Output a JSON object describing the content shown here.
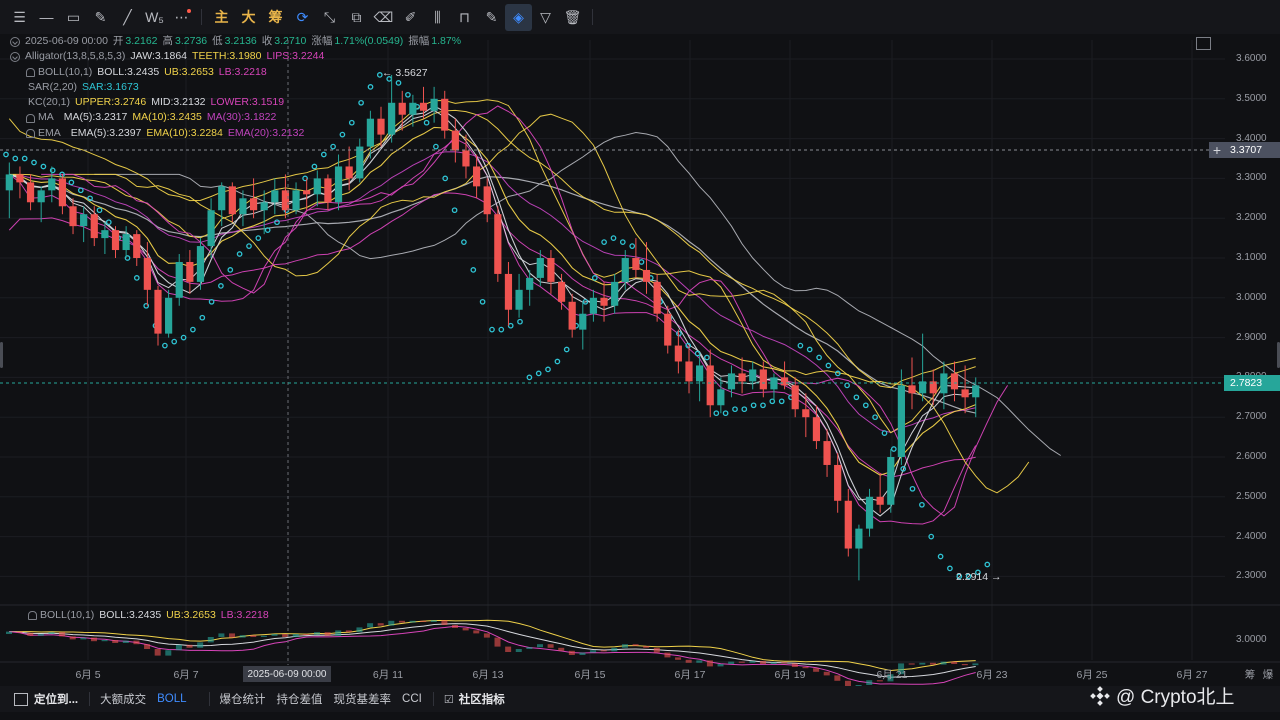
{
  "toolbar": {
    "tools": [
      {
        "icon": "menu-icon",
        "glyph": "☰"
      },
      {
        "icon": "horizontal-line-icon",
        "glyph": "—"
      },
      {
        "icon": "rectangle-icon",
        "glyph": "▭"
      },
      {
        "icon": "pen-icon",
        "glyph": "✎"
      },
      {
        "icon": "trend-line-icon",
        "glyph": "╱"
      },
      {
        "icon": "wave-icon",
        "glyph": "W₅"
      },
      {
        "icon": "more-icon",
        "glyph": "⋯"
      }
    ],
    "cn_buttons": [
      "主",
      "大",
      "筹"
    ],
    "tools2": [
      {
        "icon": "replay-icon",
        "glyph": "⟳"
      },
      {
        "icon": "measure-icon",
        "glyph": "⤡"
      },
      {
        "icon": "copy-icon",
        "glyph": "⧉"
      },
      {
        "icon": "eraser-icon",
        "glyph": "⌫"
      },
      {
        "icon": "highlighter-icon",
        "glyph": "✐"
      },
      {
        "icon": "candles-icon",
        "glyph": "⫼"
      },
      {
        "icon": "lock-icon",
        "glyph": "⊓"
      },
      {
        "icon": "edit-icon",
        "glyph": "✎"
      },
      {
        "icon": "magnet-icon",
        "glyph": "◈"
      },
      {
        "icon": "filter-icon",
        "glyph": "▽"
      },
      {
        "icon": "trash-icon",
        "glyph": "🗑"
      }
    ]
  },
  "legend": {
    "ohlc": {
      "date": "2025-06-09 00:00",
      "open_label": "开",
      "open": "3.2162",
      "high_label": "高",
      "high": "3.2736",
      "low_label": "低",
      "low": "3.2136",
      "close_label": "收",
      "close": "3.2710",
      "change_label": "涨幅",
      "change": "1.71%(0.0549)",
      "amp_label": "振幅",
      "amp": "1.87%"
    },
    "alligator": {
      "name": "Alligator(13,8,5,8,5,3)",
      "jaw": "JAW:3.1864",
      "teeth": "TEETH:3.1980",
      "lips": "LIPS:3.2244"
    },
    "boll": {
      "name": "BOLL(10,1)",
      "boll": "BOLL:3.2435",
      "ub": "UB:3.2653",
      "lb": "LB:3.2218"
    },
    "sar": {
      "name": "SAR(2,20)",
      "sar": "SAR:3.1673"
    },
    "kc": {
      "name": "KC(20,1)",
      "upper": "UPPER:3.2746",
      "mid": "MID:3.2132",
      "lower": "LOWER:3.1519"
    },
    "ma": {
      "name": "MA",
      "ma5": "MA(5):3.2317",
      "ma10": "MA(10):3.2435",
      "ma30": "MA(30):3.1822"
    },
    "ema": {
      "name": "EMA",
      "ema5": "EMA(5):3.2397",
      "ema10": "EMA(10):3.2284",
      "ema20": "EMA(20):3.2132"
    }
  },
  "sub_legend": {
    "name": "BOLL(10,1)",
    "boll": "BOLL:3.2435",
    "ub": "UB:3.2653",
    "lb": "LB:3.2218"
  },
  "annotations": {
    "high": "← 3.5627",
    "low": "2.2914 →"
  },
  "price_tags": {
    "crosshair": "3.3707",
    "last": "2.7823"
  },
  "sub_axis_label": "3.0000",
  "date_axis": {
    "ticks": [
      "6月 5",
      "6月 7",
      "6月 11",
      "6月 13",
      "6月 15",
      "6月 17",
      "6月 19",
      "6月 21",
      "6月 23",
      "6月 25",
      "6月 27"
    ],
    "crosshair": "2025-06-09 00:00",
    "right_labels": [
      "筹",
      "爆"
    ]
  },
  "bottombar": {
    "items": [
      "定位到...",
      "大额成交",
      "BOLL",
      "爆仓统计",
      "持仓差值",
      "现货基差率",
      "CCI",
      "社区指标"
    ]
  },
  "watermark": "@ Crypto北上",
  "colors": {
    "up": "#26a69a",
    "down": "#ef5350",
    "sar": "#2fc4d4",
    "yellow": "#f0d24a",
    "pink": "#d744b9",
    "grey": "#a9abb0",
    "last_tag": "#26a69a",
    "cross_tag": "#4c5160"
  },
  "chart_data": {
    "type": "candlestick",
    "ylim": [
      2.22,
      3.62
    ],
    "y_ticks": [
      2.3,
      2.4,
      2.5,
      2.6,
      2.7,
      2.8,
      2.9,
      3.0,
      3.1,
      3.2,
      3.3,
      3.4,
      3.5,
      3.6
    ],
    "candles": [
      [
        3.27,
        3.34,
        3.2,
        3.31
      ],
      [
        3.31,
        3.33,
        3.25,
        3.29
      ],
      [
        3.29,
        3.31,
        3.22,
        3.24
      ],
      [
        3.24,
        3.28,
        3.19,
        3.27
      ],
      [
        3.27,
        3.33,
        3.24,
        3.3
      ],
      [
        3.3,
        3.31,
        3.21,
        3.23
      ],
      [
        3.23,
        3.25,
        3.16,
        3.18
      ],
      [
        3.18,
        3.23,
        3.14,
        3.21
      ],
      [
        3.21,
        3.23,
        3.13,
        3.15
      ],
      [
        3.15,
        3.19,
        3.11,
        3.17
      ],
      [
        3.17,
        3.18,
        3.1,
        3.12
      ],
      [
        3.12,
        3.18,
        3.1,
        3.16
      ],
      [
        3.16,
        3.17,
        3.08,
        3.1
      ],
      [
        3.1,
        3.14,
        2.98,
        3.02
      ],
      [
        3.02,
        3.03,
        2.88,
        2.91
      ],
      [
        2.91,
        3.02,
        2.9,
        3.0
      ],
      [
        3.0,
        3.11,
        2.98,
        3.09
      ],
      [
        3.09,
        3.12,
        3.01,
        3.04
      ],
      [
        3.04,
        3.15,
        3.02,
        3.13
      ],
      [
        3.13,
        3.25,
        3.1,
        3.22
      ],
      [
        3.22,
        3.29,
        3.18,
        3.28
      ],
      [
        3.28,
        3.29,
        3.19,
        3.21
      ],
      [
        3.21,
        3.27,
        3.18,
        3.25
      ],
      [
        3.25,
        3.3,
        3.2,
        3.22
      ],
      [
        3.22,
        3.27,
        3.16,
        3.24
      ],
      [
        3.24,
        3.3,
        3.21,
        3.27
      ],
      [
        3.27,
        3.31,
        3.2,
        3.22
      ],
      [
        3.22,
        3.29,
        3.21,
        3.27
      ],
      [
        3.27,
        3.3,
        3.22,
        3.26
      ],
      [
        3.26,
        3.32,
        3.23,
        3.3
      ],
      [
        3.3,
        3.31,
        3.22,
        3.24
      ],
      [
        3.24,
        3.36,
        3.22,
        3.33
      ],
      [
        3.33,
        3.38,
        3.27,
        3.3
      ],
      [
        3.3,
        3.4,
        3.29,
        3.38
      ],
      [
        3.38,
        3.47,
        3.35,
        3.45
      ],
      [
        3.45,
        3.48,
        3.38,
        3.41
      ],
      [
        3.41,
        3.56,
        3.39,
        3.49
      ],
      [
        3.49,
        3.52,
        3.42,
        3.46
      ],
      [
        3.46,
        3.51,
        3.43,
        3.49
      ],
      [
        3.49,
        3.53,
        3.45,
        3.47
      ],
      [
        3.47,
        3.53,
        3.44,
        3.5
      ],
      [
        3.5,
        3.52,
        3.4,
        3.42
      ],
      [
        3.42,
        3.45,
        3.34,
        3.37
      ],
      [
        3.37,
        3.41,
        3.3,
        3.33
      ],
      [
        3.33,
        3.36,
        3.25,
        3.28
      ],
      [
        3.28,
        3.3,
        3.19,
        3.21
      ],
      [
        3.21,
        3.23,
        3.04,
        3.06
      ],
      [
        3.06,
        3.09,
        2.93,
        2.97
      ],
      [
        2.97,
        3.06,
        2.95,
        3.02
      ],
      [
        3.02,
        3.07,
        2.98,
        3.05
      ],
      [
        3.05,
        3.12,
        3.03,
        3.1
      ],
      [
        3.1,
        3.12,
        3.01,
        3.04
      ],
      [
        3.04,
        3.06,
        2.97,
        2.99
      ],
      [
        2.99,
        3.01,
        2.9,
        2.92
      ],
      [
        2.92,
        2.99,
        2.87,
        2.96
      ],
      [
        2.96,
        3.02,
        2.94,
        3.0
      ],
      [
        3.0,
        3.04,
        2.94,
        2.98
      ],
      [
        2.98,
        3.06,
        2.96,
        3.04
      ],
      [
        3.04,
        3.12,
        3.02,
        3.1
      ],
      [
        3.1,
        3.15,
        3.05,
        3.07
      ],
      [
        3.07,
        3.14,
        3.01,
        3.04
      ],
      [
        3.04,
        3.06,
        2.94,
        2.96
      ],
      [
        2.96,
        2.98,
        2.86,
        2.88
      ],
      [
        2.88,
        2.92,
        2.81,
        2.84
      ],
      [
        2.84,
        2.88,
        2.76,
        2.79
      ],
      [
        2.79,
        2.86,
        2.74,
        2.83
      ],
      [
        2.83,
        2.87,
        2.7,
        2.73
      ],
      [
        2.73,
        2.8,
        2.71,
        2.77
      ],
      [
        2.77,
        2.83,
        2.75,
        2.81
      ],
      [
        2.81,
        2.85,
        2.76,
        2.79
      ],
      [
        2.79,
        2.84,
        2.77,
        2.82
      ],
      [
        2.82,
        2.84,
        2.75,
        2.77
      ],
      [
        2.77,
        2.81,
        2.74,
        2.8
      ],
      [
        2.8,
        2.84,
        2.77,
        2.78
      ],
      [
        2.78,
        2.8,
        2.7,
        2.72
      ],
      [
        2.72,
        2.76,
        2.65,
        2.7
      ],
      [
        2.7,
        2.73,
        2.62,
        2.64
      ],
      [
        2.64,
        2.67,
        2.55,
        2.58
      ],
      [
        2.58,
        2.61,
        2.46,
        2.49
      ],
      [
        2.49,
        2.52,
        2.35,
        2.37
      ],
      [
        2.37,
        2.43,
        2.29,
        2.42
      ],
      [
        2.42,
        2.52,
        2.4,
        2.5
      ],
      [
        2.5,
        2.56,
        2.46,
        2.48
      ],
      [
        2.48,
        2.62,
        2.46,
        2.6
      ],
      [
        2.6,
        2.82,
        2.58,
        2.78
      ],
      [
        2.78,
        2.85,
        2.72,
        2.76
      ],
      [
        2.76,
        2.91,
        2.74,
        2.79
      ],
      [
        2.79,
        2.82,
        2.73,
        2.76
      ],
      [
        2.76,
        2.84,
        2.72,
        2.81
      ],
      [
        2.81,
        2.84,
        2.74,
        2.77
      ],
      [
        2.77,
        2.83,
        2.71,
        2.75
      ],
      [
        2.75,
        2.8,
        2.7,
        2.78
      ]
    ],
    "sar": [
      3.36,
      3.35,
      3.35,
      3.34,
      3.33,
      3.32,
      3.31,
      3.29,
      3.27,
      3.25,
      3.22,
      3.19,
      3.15,
      3.1,
      3.05,
      2.98,
      2.93,
      2.88,
      2.89,
      2.9,
      2.92,
      2.95,
      2.99,
      3.03,
      3.07,
      3.11,
      3.13,
      3.15,
      3.17,
      3.19,
      3.22,
      3.26,
      3.3,
      3.33,
      3.36,
      3.38,
      3.41,
      3.44,
      3.49,
      3.53,
      3.56,
      3.55,
      3.54,
      3.51,
      3.48,
      3.44,
      3.38,
      3.3,
      3.22,
      3.14,
      3.07,
      2.99,
      2.92,
      2.92,
      2.93,
      2.94,
      2.8,
      2.81,
      2.82,
      2.84,
      2.87,
      2.93,
      2.99,
      3.05,
      3.14,
      3.15,
      3.14,
      3.13,
      3.09,
      3.05,
      2.99,
      2.95,
      2.91,
      2.88,
      2.86,
      2.85,
      2.71,
      2.71,
      2.72,
      2.72,
      2.73,
      2.73,
      2.74,
      2.74,
      2.75,
      2.88,
      2.87,
      2.85,
      2.83,
      2.81,
      2.78,
      2.75,
      2.73,
      2.7,
      2.66,
      2.62,
      2.57,
      2.52,
      2.48,
      2.4,
      2.35,
      2.32,
      2.3,
      2.3,
      2.31,
      2.33
    ]
  }
}
